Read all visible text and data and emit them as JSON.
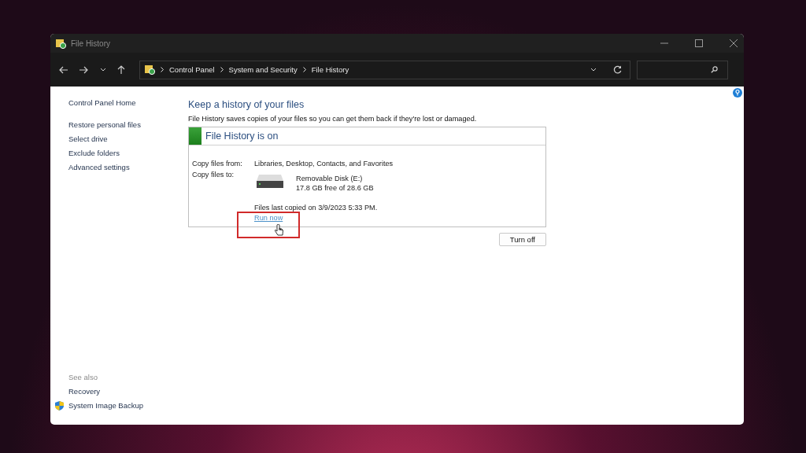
{
  "window": {
    "title": "File History"
  },
  "address_bar": {
    "crumbs": [
      "Control Panel",
      "System and Security",
      "File History"
    ]
  },
  "sidebar": {
    "home": "Control Panel Home",
    "links": [
      "Restore personal files",
      "Select drive",
      "Exclude folders",
      "Advanced settings"
    ],
    "see_also": {
      "title": "See also",
      "links": [
        {
          "label": "Recovery",
          "kind": "plain"
        },
        {
          "label": "System Image Backup",
          "kind": "shield"
        }
      ]
    }
  },
  "main": {
    "heading": "Keep a history of your files",
    "description": "File History saves copies of your files so you can get them back if they're lost or damaged.",
    "status": {
      "title": "File History is on",
      "on": true,
      "copy_from_label": "Copy files from:",
      "copy_from": "Libraries, Desktop, Contacts, and Favorites",
      "copy_to_label": "Copy files to:",
      "drive_name": "Removable Disk (E:)",
      "drive_space": "17.8 GB free of 28.6 GB",
      "last_copied": "Files last copied on 3/9/2023 5:33 PM.",
      "run_now": "Run now"
    },
    "turn_off": "Turn off"
  }
}
